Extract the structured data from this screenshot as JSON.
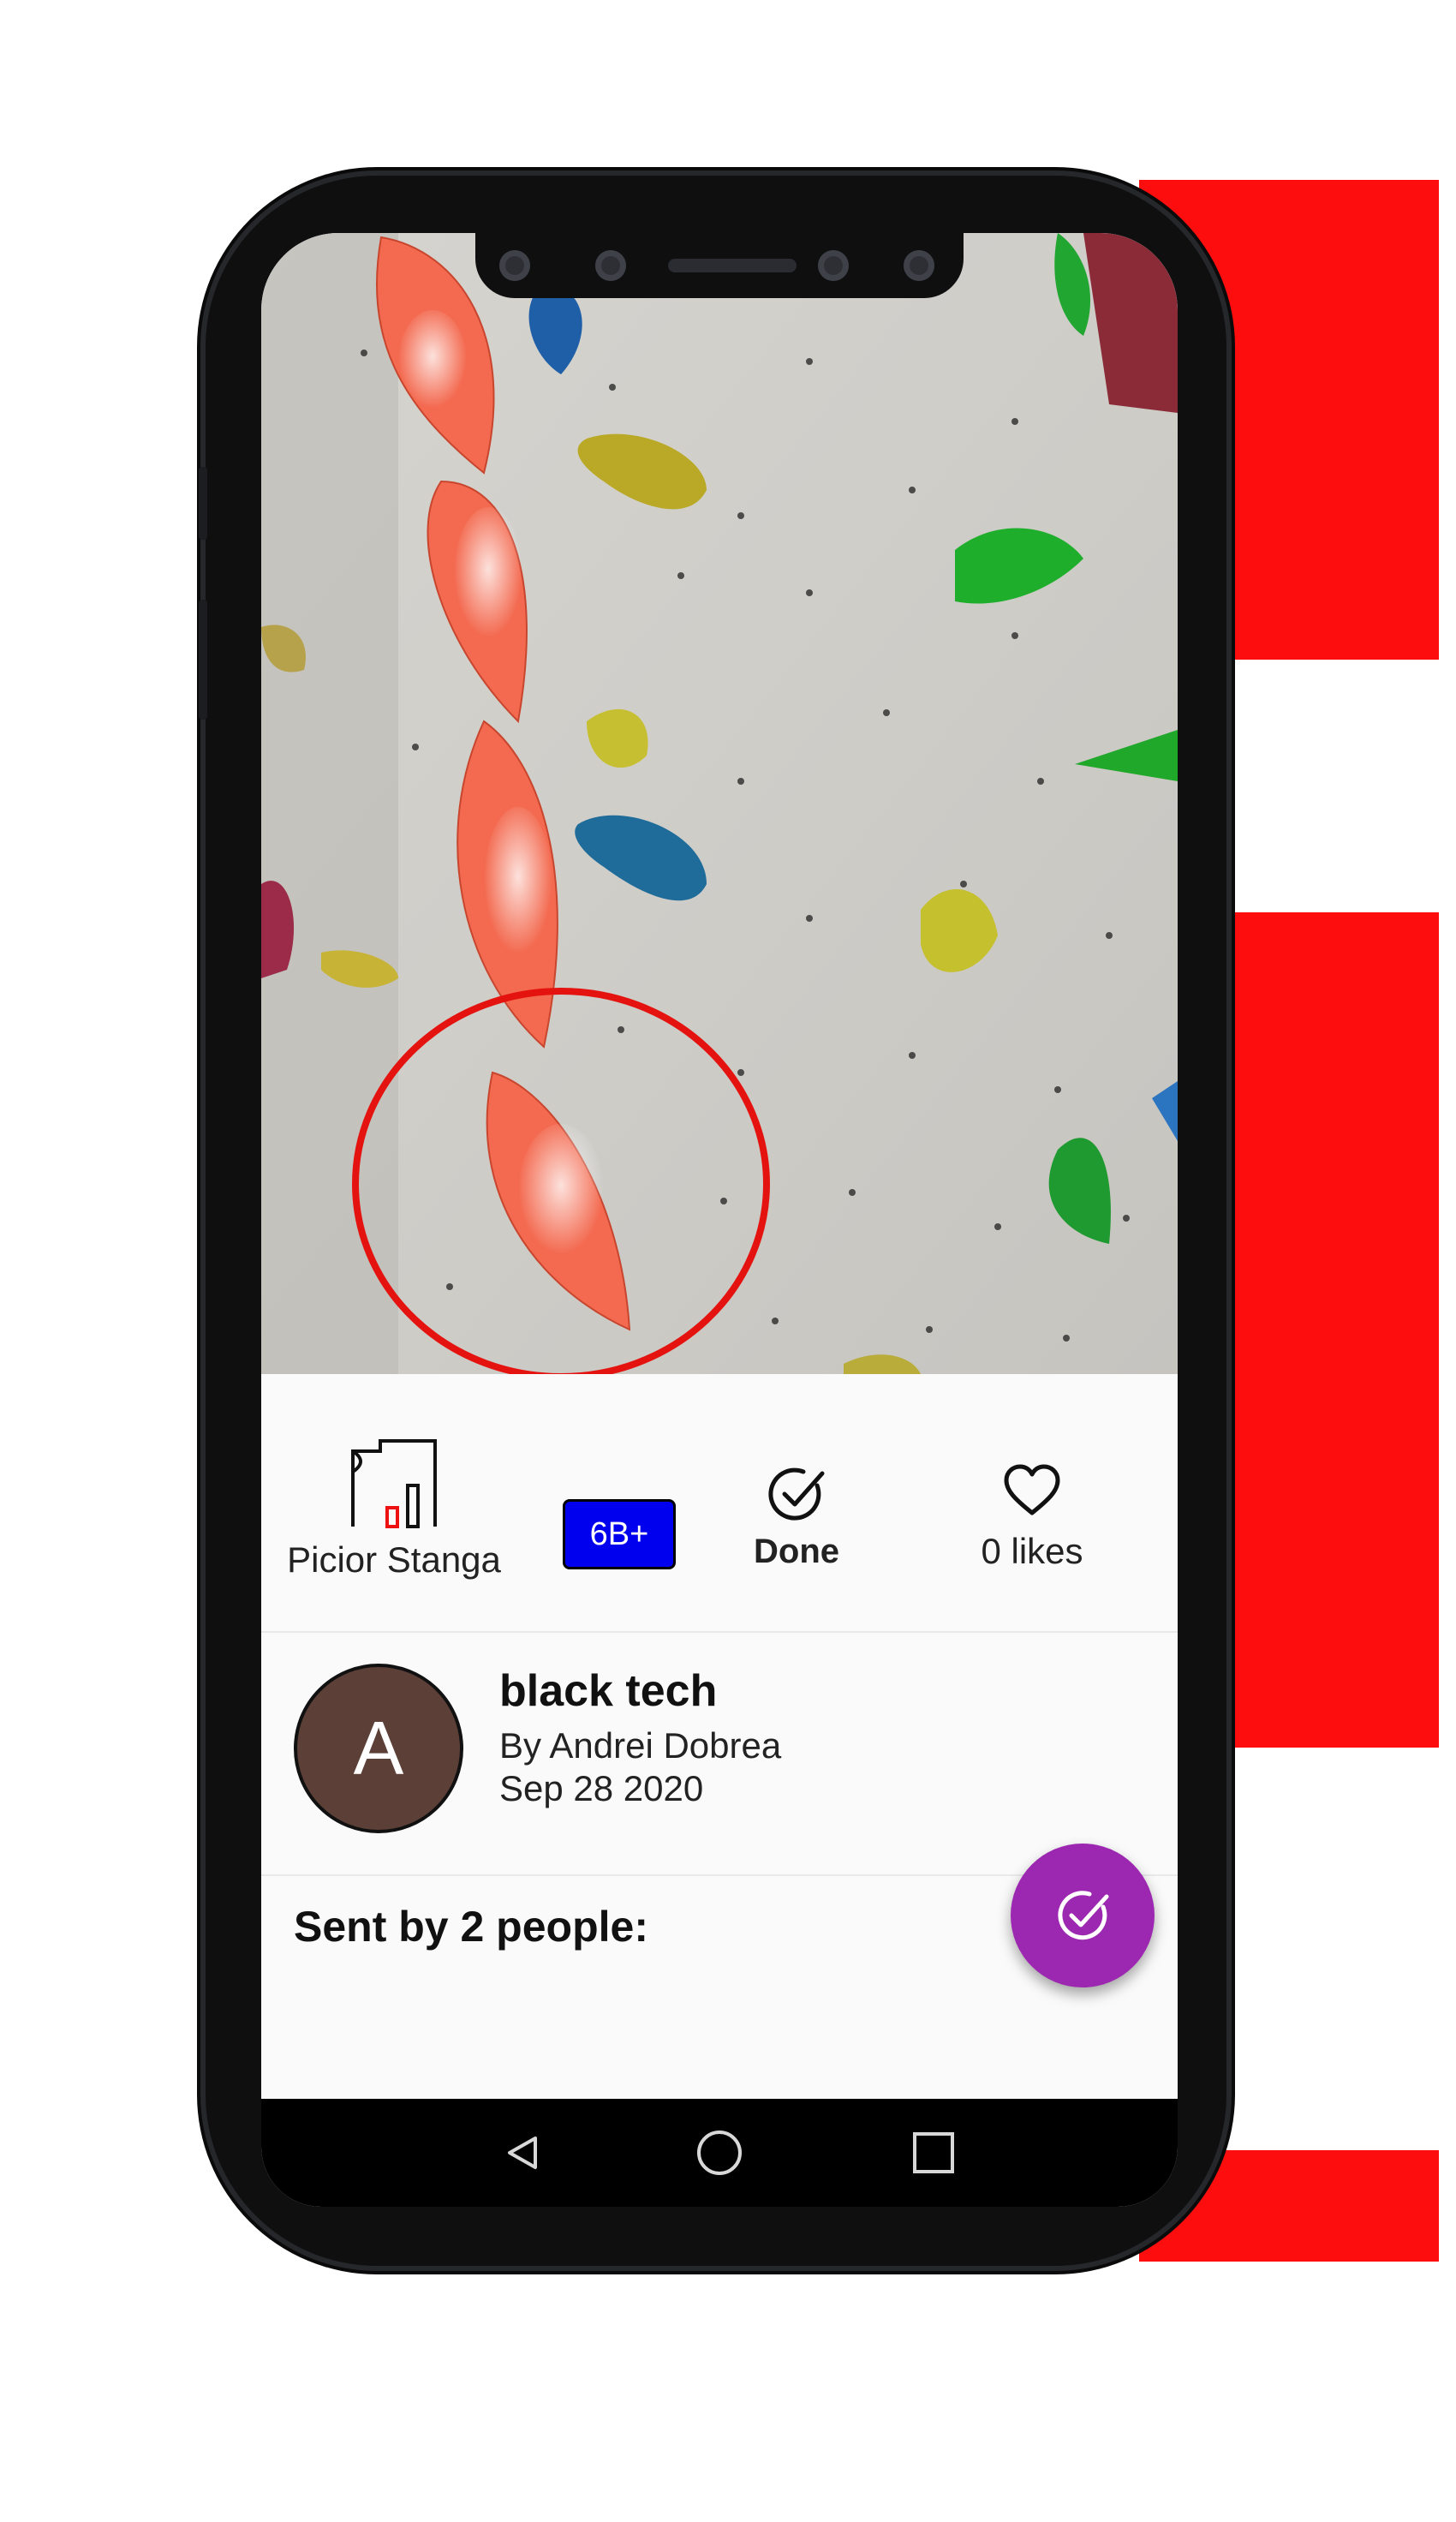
{
  "colors": {
    "accent_red": "#fd0d0d",
    "grade_badge": "#0000ee",
    "fab": "#9c27b0",
    "avatar": "#5c4037"
  },
  "route_info": {
    "sector_icon": "wall-sector-icon",
    "sector_label": "Picior Stanga",
    "grade": "6B+",
    "done_icon": "check-circle-icon",
    "done_label": "Done",
    "like_icon": "heart-outline-icon",
    "likes_label": "0 likes"
  },
  "route": {
    "avatar_letter": "A",
    "name": "black tech",
    "author": "By Andrei Dobrea",
    "date": "Sep 28 2020"
  },
  "sent_by": "Sent by 2 people:",
  "fab_icon": "check-circle-icon",
  "navbar": {
    "back_icon": "triangle-back-icon",
    "home_icon": "circle-home-icon",
    "recents_icon": "square-recents-icon"
  }
}
